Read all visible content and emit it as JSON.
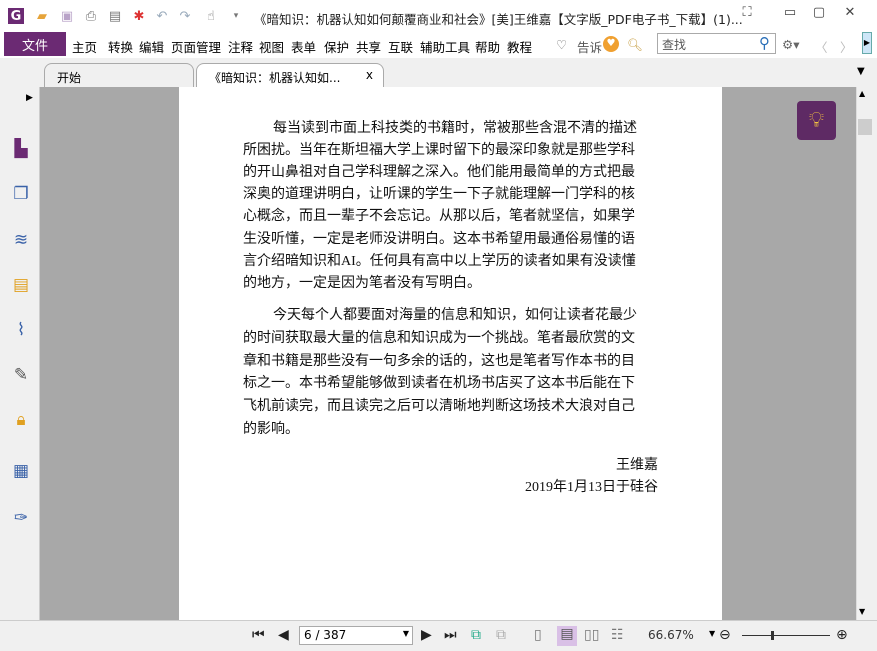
{
  "window": {
    "title": "《暗知识：机器认知如何颠覆商业和社会》[美]王维嘉【文字版_PDF电子书_下载】(1)...",
    "min": "▭",
    "max": "▢",
    "close": "✕",
    "restore": "⛶"
  },
  "menu": {
    "file": "文件",
    "items": [
      "主页",
      "转换",
      "编辑",
      "页面管理",
      "注释",
      "视图",
      "表单",
      "保护",
      "共享",
      "互联",
      "辅助工具",
      "帮助",
      "教程"
    ],
    "tell": "告诉",
    "search_placeholder": "查找"
  },
  "tabs": [
    {
      "label": "开始"
    },
    {
      "label": "《暗知识：机器认知如...",
      "close": "x"
    }
  ],
  "document": {
    "paragraph1": [
      "每当读到市面上科技类的书籍时，常被那些含混不清的描述",
      "所困扰。当年在斯坦福大学上课时留下的最深印象就是那些学科",
      "的开山鼻祖对自己学科理解之深入。他们能用最简单的方式把最",
      "深奥的道理讲明白，让听课的学生一下子就能理解一门学科的核",
      "心概念，而且一辈子不会忘记。从那以后，笔者就坚信，如果学",
      "生没听懂，一定是老师没讲明白。这本书希望用最通俗易懂的语",
      "言介绍暗知识和AI。任何具有高中以上学历的读者如果有没读懂",
      "的地方，一定是因为笔者没有写明白。"
    ],
    "paragraph2": [
      "今天每个人都要面对海量的信息和知识，如何让读者花最少",
      "的时间获取最大量的信息和知识成为一个挑战。笔者最欣赏的文",
      "章和书籍是那些没有一句多余的话的，这也是笔者写作本书的目",
      "标之一。本书希望能够做到读者在机场书店买了这本书后能在下",
      "飞机前读完，而且读完之后可以清晰地判断这场技术大浪对自己",
      "的影响。"
    ],
    "author": "王维嘉",
    "date": "2019年1月13日于硅谷"
  },
  "status": {
    "page": "6 / 387",
    "zoom": "66.67%"
  },
  "colors": {
    "accent": "#6b2a73"
  }
}
